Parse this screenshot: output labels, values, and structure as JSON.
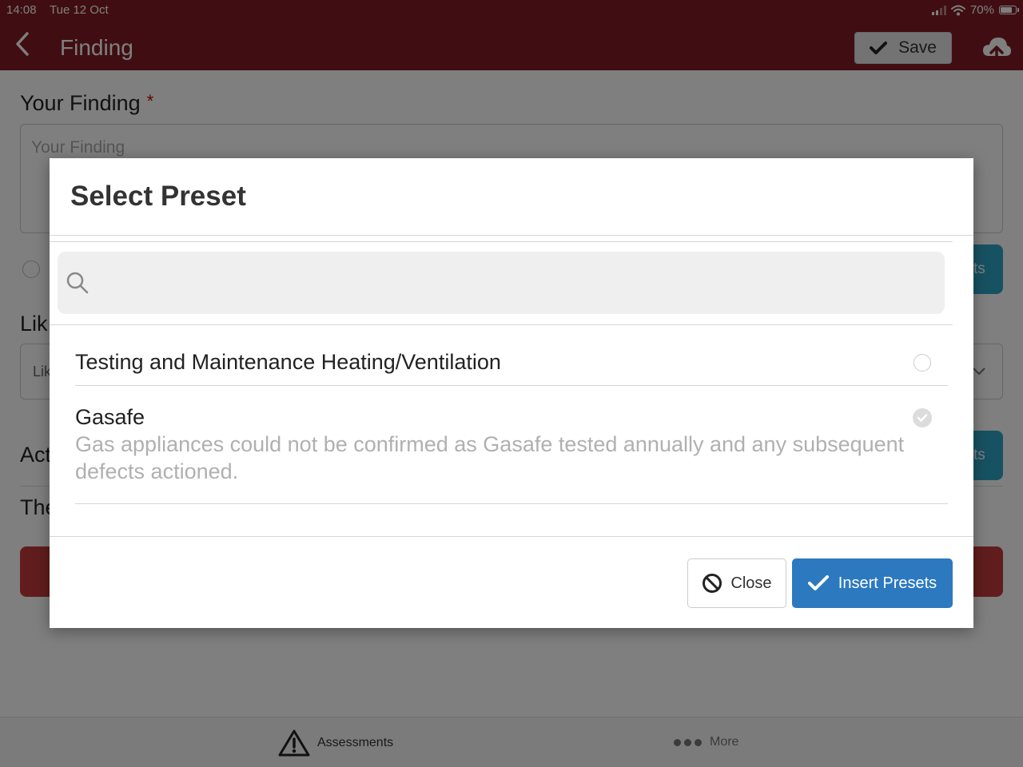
{
  "status_bar": {
    "time": "14:08",
    "date": "Tue 12 Oct",
    "battery": "70%"
  },
  "header": {
    "title": "Finding",
    "save_label": "Save",
    "color": "#801d24"
  },
  "form": {
    "your_finding_label": "Your Finding",
    "required_mark": "*",
    "your_finding_placeholder": "Your Finding",
    "teal_button_partial": "ts",
    "likelihood_label_partial": "Lik",
    "likelihood_value_partial": "Lik",
    "action_label_partial": "Act",
    "action_text_partial": "The",
    "teal_button_partial_2": "ts"
  },
  "modal": {
    "title": "Select Preset",
    "search_placeholder": "",
    "presets": [
      {
        "name": "Testing and Maintenance Heating/Ventilation",
        "description": "",
        "selected": false
      },
      {
        "name": "Gasafe",
        "description": "Gas appliances could not be confirmed as Gasafe tested annually and any subsequent defects actioned.",
        "selected": true
      }
    ],
    "close_label": "Close",
    "insert_label": "Insert Presets",
    "insert_color": "#2c79c0"
  },
  "tab_bar": {
    "assessments_label": "Assessments",
    "more_label": "More"
  }
}
